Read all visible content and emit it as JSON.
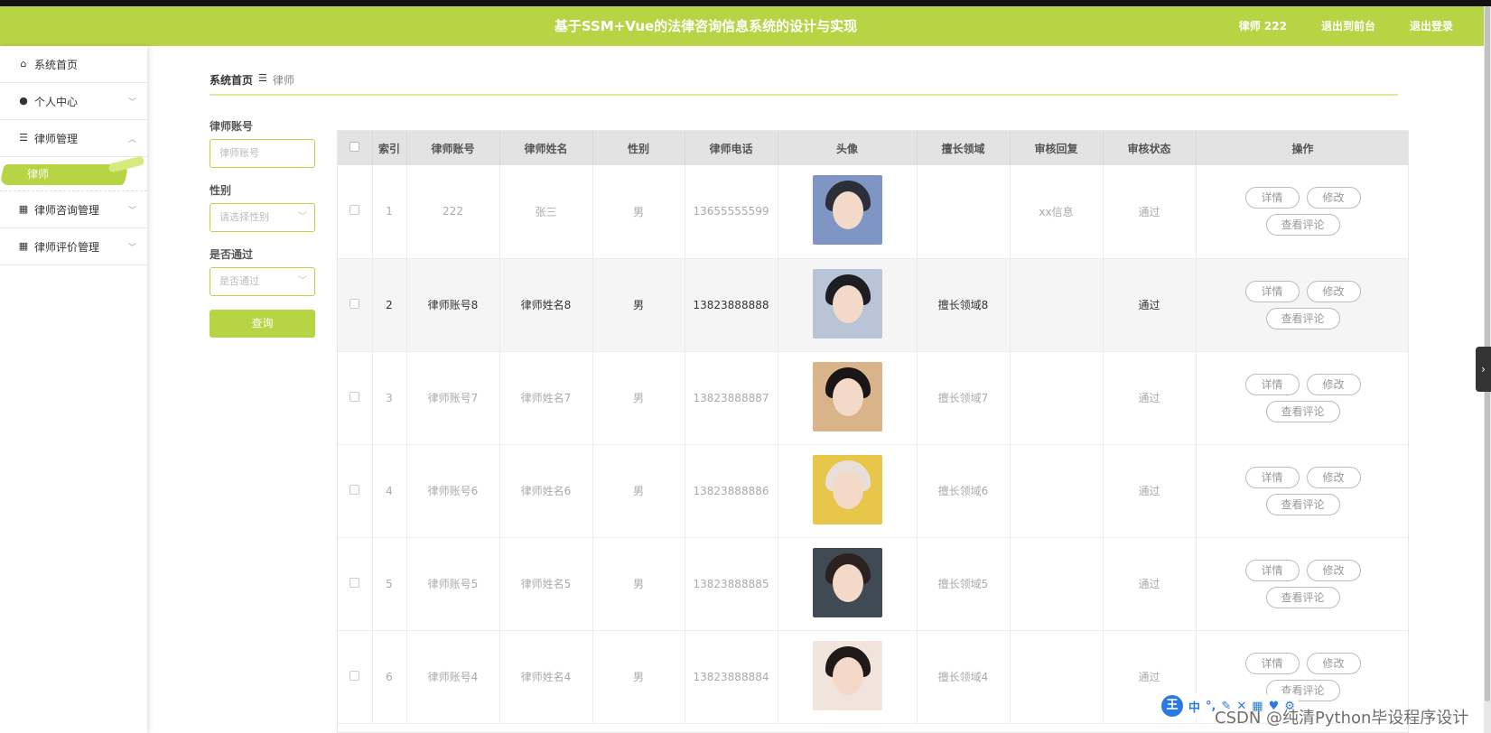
{
  "header": {
    "title": "基于SSM+Vue的法律咨询信息系统的设计与实现",
    "user": "律师 222",
    "front": "退出到前台",
    "logout": "退出登录"
  },
  "sidebar": {
    "items": [
      {
        "label": "系统首页",
        "icon": "home-icon"
      },
      {
        "label": "个人中心",
        "icon": "user-icon"
      },
      {
        "label": "律师管理",
        "icon": "list-icon"
      },
      {
        "label": "律师咨询管理",
        "icon": "grid-icon"
      },
      {
        "label": "律师评价管理",
        "icon": "grid-icon"
      }
    ],
    "submenu": {
      "label": "律师"
    }
  },
  "breadcrumb": {
    "home": "系统首页",
    "current": "律师"
  },
  "filters": {
    "account_label": "律师账号",
    "account_placeholder": "律师账号",
    "gender_label": "性别",
    "gender_placeholder": "请选择性别",
    "pass_label": "是否通过",
    "pass_placeholder": "是否通过",
    "query": "查询"
  },
  "table": {
    "headers": [
      "索引",
      "律师账号",
      "律师姓名",
      "性别",
      "律师电话",
      "头像",
      "擅长领域",
      "审核回复",
      "审核状态",
      "操作"
    ],
    "rows": [
      {
        "idx": "1",
        "account": "222",
        "name": "张三",
        "gender": "男",
        "phone": "13655555599",
        "field": "",
        "reply": "xx信息",
        "status": "通过"
      },
      {
        "idx": "2",
        "account": "律师账号8",
        "name": "律师姓名8",
        "gender": "男",
        "phone": "13823888888",
        "field": "擅长领域8",
        "reply": "",
        "status": "通过"
      },
      {
        "idx": "3",
        "account": "律师账号7",
        "name": "律师姓名7",
        "gender": "男",
        "phone": "13823888887",
        "field": "擅长领域7",
        "reply": "",
        "status": "通过"
      },
      {
        "idx": "4",
        "account": "律师账号6",
        "name": "律师姓名6",
        "gender": "男",
        "phone": "13823888886",
        "field": "擅长领域6",
        "reply": "",
        "status": "通过"
      },
      {
        "idx": "5",
        "account": "律师账号5",
        "name": "律师姓名5",
        "gender": "男",
        "phone": "13823888885",
        "field": "擅长领域5",
        "reply": "",
        "status": "通过"
      },
      {
        "idx": "6",
        "account": "律师账号4",
        "name": "律师姓名4",
        "gender": "男",
        "phone": "13823888884",
        "field": "擅长领域4",
        "reply": "",
        "status": "通过"
      }
    ],
    "ops": {
      "detail": "详情",
      "edit": "修改",
      "review": "查看评论"
    }
  },
  "ime": {
    "logo": "王",
    "mode": "中"
  },
  "watermark": "CSDN @纯清Python毕设程序设计",
  "colors": {
    "accent": "#b7d445"
  }
}
